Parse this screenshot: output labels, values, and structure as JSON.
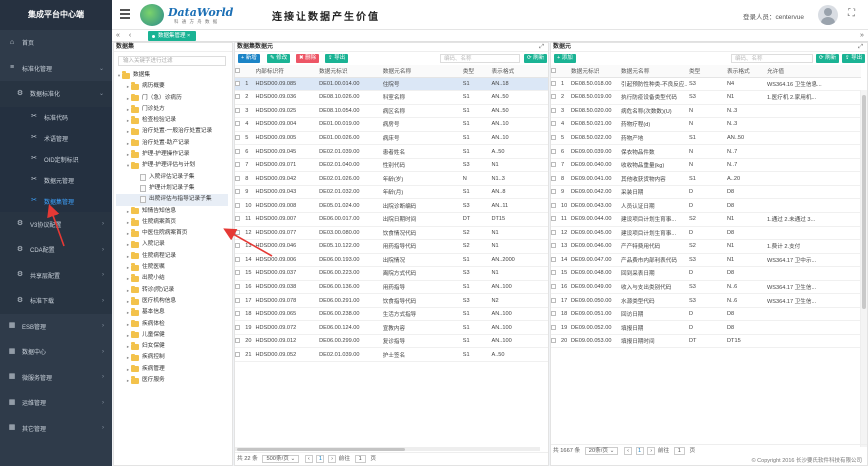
{
  "sidebar": {
    "title": "集成平台中心端",
    "items": [
      {
        "label": "首页",
        "icon": "home-icon"
      },
      {
        "label": "标准化管理",
        "icon": "layers-icon",
        "arrow": "⌄"
      },
      {
        "label": "数据标准化",
        "icon": "gear-icon",
        "arrow": "⌄"
      },
      {
        "label": "标准代码",
        "icon": "wrench-icon"
      },
      {
        "label": "术语管理",
        "icon": "wrench-icon"
      },
      {
        "label": "OID定制标识",
        "icon": "wrench-icon"
      },
      {
        "label": "数据元管理",
        "icon": "wrench-icon"
      },
      {
        "label": "数据集管理",
        "icon": "wrench-icon"
      },
      {
        "label": "V3协议配置",
        "icon": "gear-icon",
        "arrow": "›"
      },
      {
        "label": "CDA配置",
        "icon": "gear-icon",
        "arrow": "›"
      },
      {
        "label": "共享层配置",
        "icon": "gear-icon",
        "arrow": "›"
      },
      {
        "label": "标准下载",
        "icon": "gear-icon",
        "arrow": "›"
      },
      {
        "label": "ESB管理",
        "icon": "grid-icon",
        "arrow": "›"
      },
      {
        "label": "数据中心",
        "icon": "grid-icon",
        "arrow": "›"
      },
      {
        "label": "微服务管理",
        "icon": "grid-icon",
        "arrow": "›"
      },
      {
        "label": "运维管理",
        "icon": "grid-icon",
        "arrow": "›"
      },
      {
        "label": "其它管理",
        "icon": "grid-icon",
        "arrow": "›"
      }
    ]
  },
  "header": {
    "logo_text": "DataWorld",
    "logo_sub": "科 通 方 舟 数 据",
    "slogan": "连接让数据产生价值",
    "login_label": "登录人员：centervue",
    "fullscreen_glyph": "⛶"
  },
  "tabs": {
    "prev": "«",
    "next": "»",
    "active_tab": "数据集管理 ×"
  },
  "dataset_panel": {
    "title": "数据集",
    "search_placeholder": "输入关键字进行过滤",
    "tree": [
      {
        "label": "数据集",
        "level": 0,
        "type": "folder",
        "caret": "▾"
      },
      {
        "label": "病历概要",
        "level": 1,
        "type": "folder",
        "caret": "▸"
      },
      {
        "label": "门（急）诊病历",
        "level": 1,
        "type": "folder",
        "caret": "▸"
      },
      {
        "label": "门诊处方",
        "level": 1,
        "type": "folder",
        "caret": "▸"
      },
      {
        "label": "检查检验记录",
        "level": 1,
        "type": "folder",
        "caret": "▸"
      },
      {
        "label": "治疗处置-一般治疗处置记录",
        "level": 1,
        "type": "folder",
        "caret": "▸"
      },
      {
        "label": "治疗处置-助产记录",
        "level": 1,
        "type": "folder",
        "caret": "▸"
      },
      {
        "label": "护理-护理操作记录",
        "level": 1,
        "type": "folder",
        "caret": "▸"
      },
      {
        "label": "护理-护理评估与计划",
        "level": 1,
        "type": "folder",
        "caret": "▾"
      },
      {
        "label": "入院评估记录子集",
        "level": 2,
        "type": "file",
        "caret": ""
      },
      {
        "label": "护理计划记录子集",
        "level": 2,
        "type": "file",
        "caret": ""
      },
      {
        "label": "出院评估与指导记录子集",
        "level": 2,
        "type": "file",
        "caret": "",
        "selected": true
      },
      {
        "label": "知情告知信息",
        "level": 1,
        "type": "folder",
        "caret": "▸"
      },
      {
        "label": "住院病案首页",
        "level": 1,
        "type": "folder",
        "caret": "▸"
      },
      {
        "label": "中医住院病案首页",
        "level": 1,
        "type": "folder",
        "caret": "▸"
      },
      {
        "label": "入院记录",
        "level": 1,
        "type": "folder",
        "caret": "▸"
      },
      {
        "label": "住院病程记录",
        "level": 1,
        "type": "folder",
        "caret": "▸"
      },
      {
        "label": "住院医嘱",
        "level": 1,
        "type": "folder",
        "caret": "▸"
      },
      {
        "label": "出院小结",
        "level": 1,
        "type": "folder",
        "caret": "▸"
      },
      {
        "label": "转诊(院)记录",
        "level": 1,
        "type": "folder",
        "caret": "▸"
      },
      {
        "label": "医疗机构信息",
        "level": 1,
        "type": "folder",
        "caret": "▸"
      },
      {
        "label": "基本信息",
        "level": 1,
        "type": "folder",
        "caret": "▸"
      },
      {
        "label": "疾病体检",
        "level": 1,
        "type": "folder",
        "caret": "▸"
      },
      {
        "label": "儿童保健",
        "level": 1,
        "type": "folder",
        "caret": "▸"
      },
      {
        "label": "妇女保健",
        "level": 1,
        "type": "folder",
        "caret": "▸"
      },
      {
        "label": "疾病控制",
        "level": 1,
        "type": "folder",
        "caret": "▸"
      },
      {
        "label": "疾病管理",
        "level": 1,
        "type": "folder",
        "caret": "▸"
      },
      {
        "label": "医疗服务",
        "level": 1,
        "type": "folder",
        "caret": "▸"
      }
    ]
  },
  "middle_panel": {
    "title": "数据集数据元",
    "buttons": {
      "add": "+ 新增",
      "edit": "✎ 修改",
      "delete": "✖ 删除",
      "export": "⇪ 导出",
      "refresh": "⟳ 刷新"
    },
    "search_placeholder": "编码、名称",
    "columns": [
      "内部标识符",
      "数据元标识",
      "数据元名称",
      "类型",
      "表示格式"
    ],
    "rows": [
      [
        "HDSD00.09.085",
        "DE01.00.014.00",
        "住院号",
        "S1",
        "AN..18"
      ],
      [
        "HDSD00.09.036",
        "DE08.10.026.00",
        "科室名称",
        "S1",
        "AN..50"
      ],
      [
        "HDSD00.09.025",
        "DE08.10.054.00",
        "病区名称",
        "S1",
        "AN..50"
      ],
      [
        "HDSD00.09.004",
        "DE01.00.019.00",
        "病房号",
        "S1",
        "AN..10"
      ],
      [
        "HDSD00.09.005",
        "DE01.00.026.00",
        "病床号",
        "S1",
        "AN..10"
      ],
      [
        "HDSD00.09.045",
        "DE02.01.039.00",
        "患者姓名",
        "S1",
        "A..50"
      ],
      [
        "HDSD00.09.071",
        "DE02.01.040.00",
        "性别代码",
        "S3",
        "N1"
      ],
      [
        "HDSD00.09.042",
        "DE02.01.026.00",
        "年龄(岁)",
        "N",
        "N1..3"
      ],
      [
        "HDSD00.09.043",
        "DE02.01.032.00",
        "年龄(月)",
        "S1",
        "AN..8"
      ],
      [
        "HDSD00.09.008",
        "DE05.01.024.00",
        "出院诊断编码",
        "S3",
        "AN..11"
      ],
      [
        "HDSD00.09.007",
        "DE06.00.017.00",
        "出院日期时间",
        "DT",
        "DT15"
      ],
      [
        "HDSD00.09.077",
        "DE03.00.080.00",
        "饮食情况代码",
        "S2",
        "N1"
      ],
      [
        "HDSD00.09.046",
        "DE05.10.122.00",
        "用药指导代码",
        "S2",
        "N1"
      ],
      [
        "HDSD00.09.006",
        "DE06.00.193.00",
        "出院情况",
        "S1",
        "AN..2000"
      ],
      [
        "HDSD00.09.037",
        "DE06.00.223.00",
        "离院方式代码",
        "S3",
        "N1"
      ],
      [
        "HDSD00.09.038",
        "DE06.00.136.00",
        "用药指导",
        "S1",
        "AN..100"
      ],
      [
        "HDSD00.09.078",
        "DE06.00.291.00",
        "饮食指导代码",
        "S3",
        "N2"
      ],
      [
        "HDSD00.09.065",
        "DE06.00.238.00",
        "生活方式指导",
        "S1",
        "AN..100"
      ],
      [
        "HDSD00.09.072",
        "DE06.00.124.00",
        "宣教内容",
        "S1",
        "AN..100"
      ],
      [
        "HDSD00.09.012",
        "DE06.00.299.00",
        "复诊指导",
        "S1",
        "AN..100"
      ],
      [
        "HDSD00.09.052",
        "DE02.01.039.00",
        "护士签名",
        "S1",
        "A..50"
      ]
    ],
    "highlighted_row": 0,
    "pager": {
      "total": "共 22 条",
      "size": "500条/页 ⌄",
      "prev": "‹",
      "page": "1",
      "next": "›",
      "goto_label": "前往",
      "goto_value": "1",
      "goto_suffix": "页"
    }
  },
  "right_panel": {
    "title": "数据元",
    "buttons": {
      "add": "+ 添加",
      "refresh": "⟳ 刷新",
      "export": "⇪ 导出"
    },
    "search_placeholder": "编码、名称",
    "columns": [
      "数据元标识",
      "数据元名称",
      "类型",
      "表示格式",
      "允许值"
    ],
    "rows": [
      [
        "DE08.50.018.00",
        "引起预防性种类-不良反应...",
        "S3",
        "N4",
        "WS364.16 卫生信息..."
      ],
      [
        "DE08.50.019.00",
        "执行防疫设备类型代码",
        "S3",
        "N1",
        "1.医疗机 2.家用机..."
      ],
      [
        "DE08.50.020.00",
        "病危名称(次数数)(U)",
        "N",
        "N..3",
        ""
      ],
      [
        "DE08.50.021.00",
        "药物疗程(d)",
        "N",
        "N..3",
        ""
      ],
      [
        "DE08.50.022.00",
        "药物产地",
        "S1",
        "AN..50",
        ""
      ],
      [
        "DE09.00.039.00",
        "保衣物品件数",
        "N",
        "N..7",
        ""
      ],
      [
        "DE09.00.040.00",
        "收收物品重量(kg)",
        "N",
        "N..7",
        ""
      ],
      [
        "DE09.00.041.00",
        "其他收获货物内容",
        "S1",
        "A..20",
        ""
      ],
      [
        "DE09.00.042.00",
        "采装日期",
        "D",
        "D8",
        ""
      ],
      [
        "DE09.00.043.00",
        "人员认证日期",
        "D",
        "D8",
        ""
      ],
      [
        "DE09.00.044.00",
        "建设项目计划生育事...",
        "S2",
        "N1",
        "1.通过 2.未通过 3..."
      ],
      [
        "DE09.00.045.00",
        "建设项目计划生育事...",
        "D",
        "D8",
        ""
      ],
      [
        "DE09.00.046.00",
        "产产特费用代码",
        "S2",
        "N1",
        "1.费计 2.支付"
      ],
      [
        "DE09.00.047.00",
        "产品费市内部利表代码",
        "S3",
        "N1",
        "WS364.17 卫中示..."
      ],
      [
        "DE09.00.048.00",
        "回到采表日期",
        "D",
        "D8",
        ""
      ],
      [
        "DE09.00.049.00",
        "收入与支出类别代码",
        "S3",
        "N..6",
        "WS364.17 卫生信..."
      ],
      [
        "DE09.00.050.00",
        "水源类型代码",
        "S3",
        "N..6",
        "WS364.17 卫生信..."
      ],
      [
        "DE09.00.051.00",
        "回访日期",
        "D",
        "D8",
        ""
      ],
      [
        "DE09.00.052.00",
        "填报日期",
        "D",
        "D8",
        ""
      ],
      [
        "DE09.00.053.00",
        "填报日期时间",
        "DT",
        "DT15",
        ""
      ]
    ],
    "pager": {
      "total": "共 1667 条",
      "size": "20条/页 ⌄",
      "prev": "‹",
      "page": "1",
      "next": "›",
      "goto_label": "前往",
      "goto_value": "1",
      "goto_suffix": "页"
    }
  },
  "footer": {
    "copyright": "© Copyright 2016 长沙要氏软件科技有限公司"
  },
  "colors": {
    "sidebar": "#2f3b4a",
    "accent": "#1ab394",
    "highlight_row": "#dbe7f6",
    "annotation_arrow": "#e53935"
  }
}
